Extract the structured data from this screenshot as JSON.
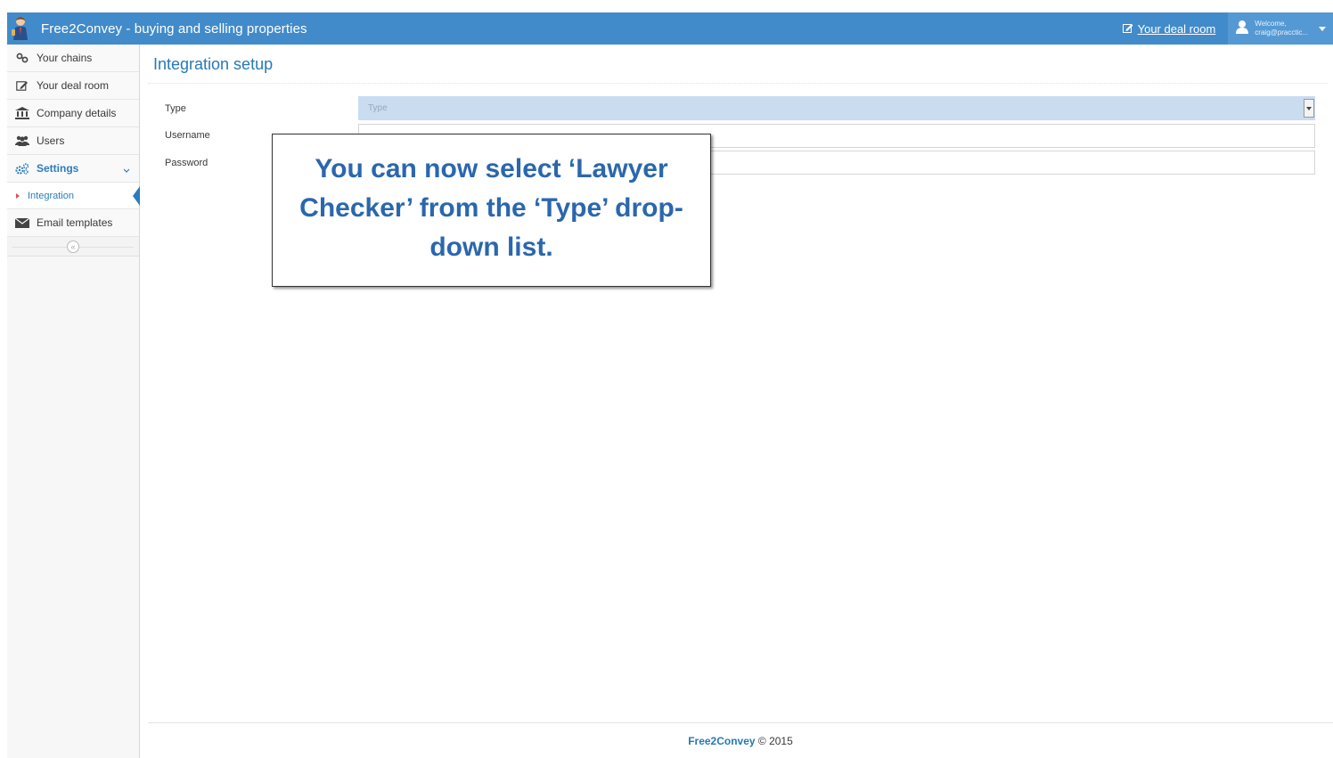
{
  "navbar": {
    "brand_title": "Free2Convey - buying and selling properties",
    "deal_room_link": "Your deal room",
    "welcome_text": "Welcome,",
    "user_email": "craig@pracctic..."
  },
  "sidebar": {
    "items": [
      {
        "label": "Your chains",
        "icon": "link-icon"
      },
      {
        "label": "Your deal room",
        "icon": "edit-icon"
      },
      {
        "label": "Company details",
        "icon": "bank-icon"
      },
      {
        "label": "Users",
        "icon": "users-icon"
      },
      {
        "label": "Settings",
        "icon": "cogs-icon"
      }
    ],
    "sub_items": [
      {
        "label": "Integration"
      }
    ],
    "bottom_items": [
      {
        "label": "Email templates",
        "icon": "envelope-icon"
      }
    ],
    "collapse_symbol": "«"
  },
  "main": {
    "title": "Integration setup",
    "form": {
      "type_label": "Type",
      "type_placeholder": "Type",
      "username_label": "Username",
      "username_value": "",
      "password_label": "Password",
      "password_value": ""
    }
  },
  "callout": {
    "text": "You can now select ‘Lawyer Checker’ from the ‘Type’ drop-down list."
  },
  "footer": {
    "brand": "Free2Convey",
    "copyright": " © 2015"
  },
  "colors": {
    "navbar": "#428bca",
    "accent": "#2679b5",
    "callout_text": "#2a67ad",
    "select_bg": "#c9dcf0"
  }
}
